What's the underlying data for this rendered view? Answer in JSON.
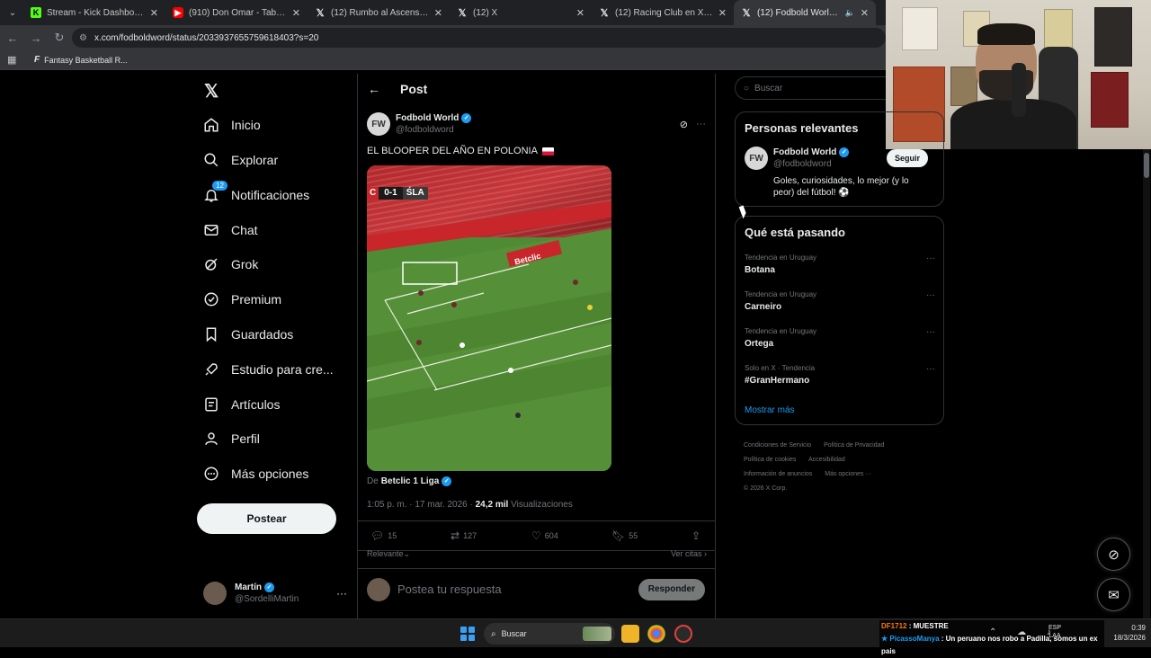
{
  "browser": {
    "tabs": [
      {
        "title": "Stream - Kick Dashboard",
        "favicon": "kick-icon",
        "active": false
      },
      {
        "title": "(910) Don Omar - Taboo - YouT",
        "favicon": "youtube-icon",
        "active": false
      },
      {
        "title": "(12) Rumbo al Ascenso en X: \"",
        "favicon": "x-icon",
        "active": false
      },
      {
        "title": "(12) X",
        "favicon": "x-icon",
        "active": false
      },
      {
        "title": "(12) Racing Club en X: \" 🏟 ¡El p",
        "favicon": "x-icon",
        "active": false
      },
      {
        "title": "(12) Fodbold World en X: \"E",
        "favicon": "x-icon",
        "active": true
      }
    ],
    "url": "x.com/fodboldword/status/2033937655759618403?s=20",
    "bookmark": "Fantasy Basketball R..."
  },
  "sidebar": {
    "logo": "𝕏",
    "items": [
      {
        "label": "Inicio",
        "icon": "home-icon"
      },
      {
        "label": "Explorar",
        "icon": "search-icon"
      },
      {
        "label": "Notificaciones",
        "icon": "bell-icon",
        "badge": "12"
      },
      {
        "label": "Chat",
        "icon": "mail-icon"
      },
      {
        "label": "Grok",
        "icon": "grok-icon"
      },
      {
        "label": "Premium",
        "icon": "premium-icon"
      },
      {
        "label": "Guardados",
        "icon": "bookmark-icon"
      },
      {
        "label": "Estudio para cre...",
        "icon": "rocket-icon"
      },
      {
        "label": "Artículos",
        "icon": "article-icon"
      },
      {
        "label": "Perfil",
        "icon": "person-icon"
      },
      {
        "label": "Más opciones",
        "icon": "more-circle-icon"
      }
    ],
    "post_button": "Postear",
    "account": {
      "name": "Martín",
      "handle": "@SordelliMartin"
    }
  },
  "main": {
    "title": "Post",
    "author": {
      "name": "Fodbold World",
      "handle": "@fodboldword"
    },
    "text": "EL BLOOPER DEL AÑO EN POLONIA",
    "video_score": {
      "home": "C",
      "score": "0-1",
      "away": "ŚLA"
    },
    "video_sponsor": "Betclic",
    "source_prefix": "De",
    "source_name": "Betclic 1 Liga",
    "time": "1:05 p. m. · 17 mar. 2026 ·",
    "views": "24,2 mil",
    "views_label": "Visualizaciones",
    "actions": {
      "replies": "15",
      "reposts": "127",
      "likes": "604",
      "bookmarks": "55"
    },
    "sort_label": "Relevante",
    "quotes_label": "Ver citas",
    "reply_placeholder": "Postea tu respuesta",
    "reply_button": "Responder"
  },
  "right": {
    "search_placeholder": "Buscar",
    "relevant_title": "Personas relevantes",
    "relevant_user": {
      "name": "Fodbold World",
      "handle": "@fodboldword",
      "bio": "Goles, curiosidades, lo mejor (y lo peor) del fútbol! ⚽",
      "follow": "Seguir"
    },
    "trends_title": "Qué está pasando",
    "trends": [
      {
        "context": "Tendencia en Uruguay",
        "name": "Botana"
      },
      {
        "context": "Tendencia en Uruguay",
        "name": "Carneiro"
      },
      {
        "context": "Tendencia en Uruguay",
        "name": "Ortega"
      },
      {
        "context": "Solo en X · Tendencia",
        "name": "#GranHermano"
      }
    ],
    "show_more": "Mostrar más",
    "footer": [
      "Condiciones de Servicio",
      "Política de Privacidad",
      "Política de cookies",
      "Accesibilidad",
      "Información de anuncios",
      "Más opciones ···",
      "© 2026 X Corp."
    ]
  },
  "taskbar": {
    "search": "Buscar",
    "chat": [
      {
        "user": "DF1712",
        "msg": "MUESTRE"
      },
      {
        "user": "PicassoManya",
        "msg": "Un peruano nos robo a Padilla, somos un ex pais"
      }
    ],
    "lang": "ESP",
    "lang_sub": "LAA",
    "time": "0:39",
    "date": "18/3/2026"
  },
  "colors": {
    "accent": "#1d9bf0",
    "background": "#000000",
    "border": "#2f3336",
    "muted": "#71767b"
  }
}
